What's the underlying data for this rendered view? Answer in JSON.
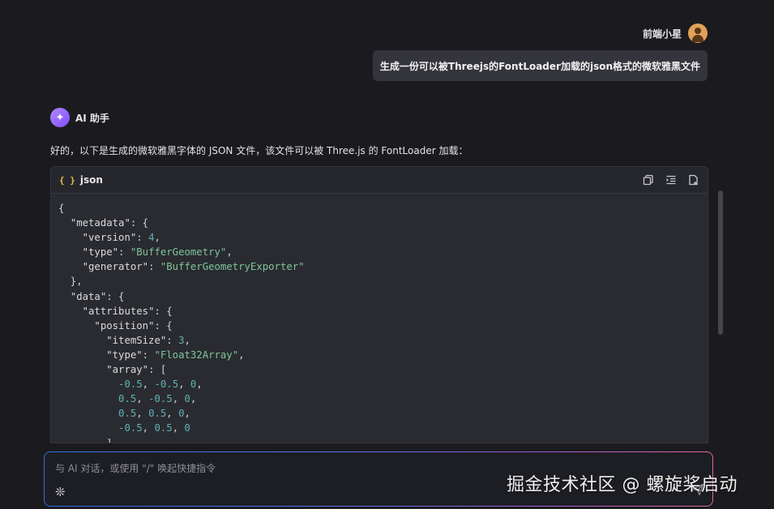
{
  "user": {
    "name": "前端小星",
    "message": "生成一份可以被Threejs的FontLoader加载的json格式的微软雅黑文件"
  },
  "assistant": {
    "name": "AI 助手",
    "intro": "好的，以下是生成的微软雅黑字体的 JSON 文件，该文件可以被 Three.js 的 FontLoader 加载：",
    "code": {
      "language": "json",
      "lines": [
        [
          [
            "p",
            "{"
          ]
        ],
        [
          [
            "p",
            "  "
          ],
          [
            "k",
            "\"metadata\""
          ],
          [
            "p",
            ": {"
          ]
        ],
        [
          [
            "p",
            "    "
          ],
          [
            "k",
            "\"version\""
          ],
          [
            "p",
            ": "
          ],
          [
            "n",
            "4"
          ],
          [
            "p",
            ","
          ]
        ],
        [
          [
            "p",
            "    "
          ],
          [
            "k",
            "\"type\""
          ],
          [
            "p",
            ": "
          ],
          [
            "s",
            "\"BufferGeometry\""
          ],
          [
            "p",
            ","
          ]
        ],
        [
          [
            "p",
            "    "
          ],
          [
            "k",
            "\"generator\""
          ],
          [
            "p",
            ": "
          ],
          [
            "s",
            "\"BufferGeometryExporter\""
          ]
        ],
        [
          [
            "p",
            "  },"
          ]
        ],
        [
          [
            "p",
            "  "
          ],
          [
            "k",
            "\"data\""
          ],
          [
            "p",
            ": {"
          ]
        ],
        [
          [
            "p",
            "    "
          ],
          [
            "k",
            "\"attributes\""
          ],
          [
            "p",
            ": {"
          ]
        ],
        [
          [
            "p",
            "      "
          ],
          [
            "k",
            "\"position\""
          ],
          [
            "p",
            ": {"
          ]
        ],
        [
          [
            "p",
            "        "
          ],
          [
            "k",
            "\"itemSize\""
          ],
          [
            "p",
            ": "
          ],
          [
            "n",
            "3"
          ],
          [
            "p",
            ","
          ]
        ],
        [
          [
            "p",
            "        "
          ],
          [
            "k",
            "\"type\""
          ],
          [
            "p",
            ": "
          ],
          [
            "s",
            "\"Float32Array\""
          ],
          [
            "p",
            ","
          ]
        ],
        [
          [
            "p",
            "        "
          ],
          [
            "k",
            "\"array\""
          ],
          [
            "p",
            ": ["
          ]
        ],
        [
          [
            "p",
            "          "
          ],
          [
            "n",
            "-0.5"
          ],
          [
            "p",
            ", "
          ],
          [
            "n",
            "-0.5"
          ],
          [
            "p",
            ", "
          ],
          [
            "n",
            "0"
          ],
          [
            "p",
            ","
          ]
        ],
        [
          [
            "p",
            "          "
          ],
          [
            "n",
            "0.5"
          ],
          [
            "p",
            ", "
          ],
          [
            "n",
            "-0.5"
          ],
          [
            "p",
            ", "
          ],
          [
            "n",
            "0"
          ],
          [
            "p",
            ","
          ]
        ],
        [
          [
            "p",
            "          "
          ],
          [
            "n",
            "0.5"
          ],
          [
            "p",
            ", "
          ],
          [
            "n",
            "0.5"
          ],
          [
            "p",
            ", "
          ],
          [
            "n",
            "0"
          ],
          [
            "p",
            ","
          ]
        ],
        [
          [
            "p",
            "          "
          ],
          [
            "n",
            "-0.5"
          ],
          [
            "p",
            ", "
          ],
          [
            "n",
            "0.5"
          ],
          [
            "p",
            ", "
          ],
          [
            "n",
            "0"
          ]
        ],
        [
          [
            "p",
            "        ]"
          ]
        ]
      ]
    }
  },
  "input": {
    "placeholder": "与 AI 对话，或使用 \"/\" 唤起快捷指令"
  },
  "watermark": "掘金技术社区 @ 螺旋桨启动",
  "colors": {
    "background": "#1b1b1f",
    "user_bubble": "#34343c",
    "code_bg": "#2a2b31",
    "string": "#7ec699",
    "number": "#5fb3b3",
    "key": "#dcdcdc"
  }
}
